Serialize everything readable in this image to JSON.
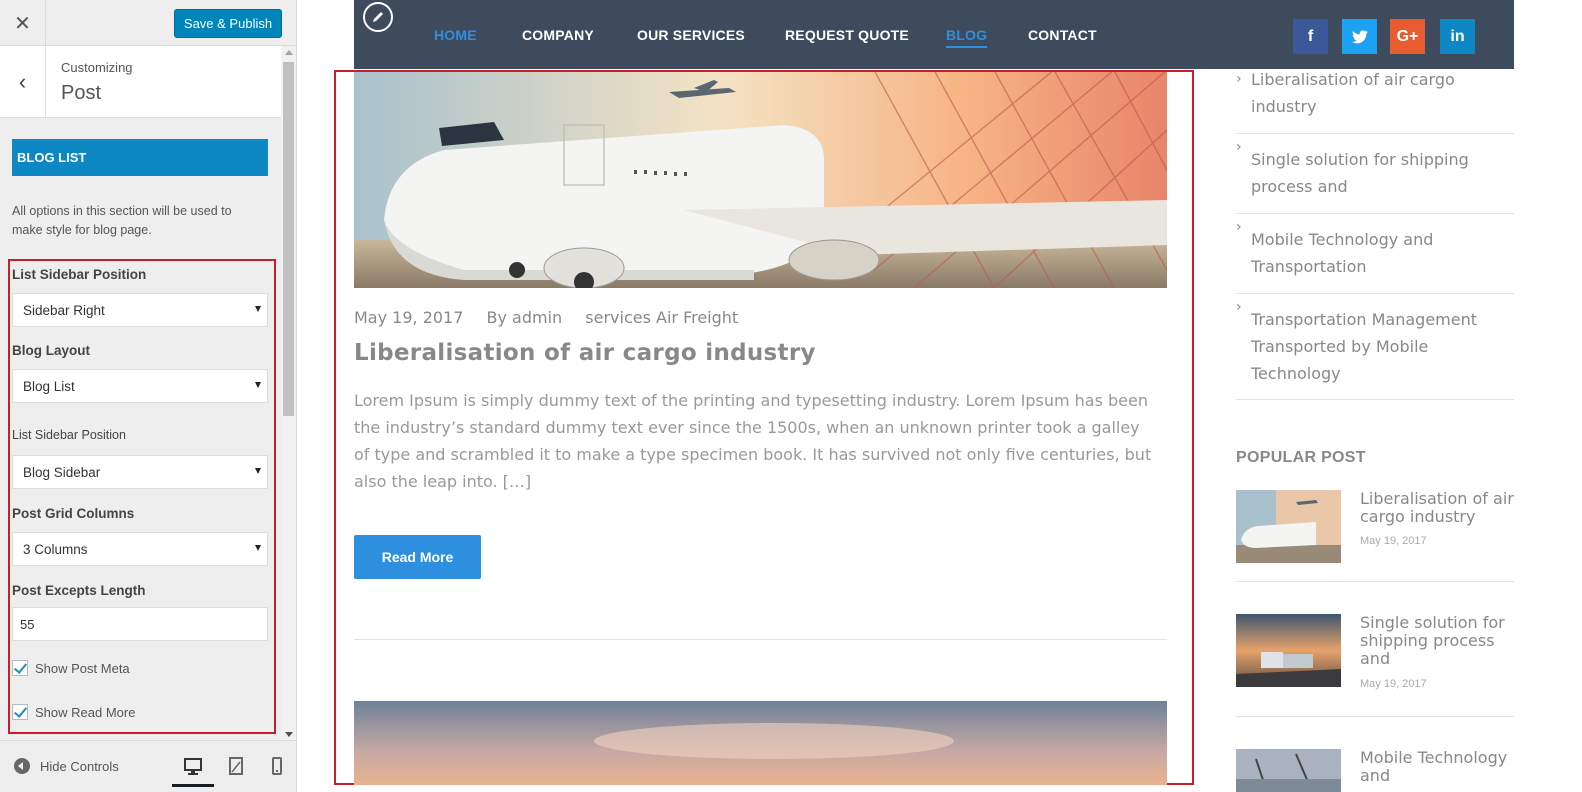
{
  "customizer": {
    "close_label": "✕",
    "publish_label": "Save & Publish",
    "breadcrumb_small": "Customizing",
    "breadcrumb_title": "Post",
    "section_label": "BLOG LIST",
    "section_desc": "All options in this section will be used to make style for blog page.",
    "options": {
      "list_sidebar_position_label": "List Sidebar Position",
      "list_sidebar_position_value": "Sidebar Right",
      "blog_layout_label": "Blog Layout",
      "blog_layout_value": "Blog List",
      "list_sidebar_position2_label": "List Sidebar Position",
      "list_sidebar_position2_value": "Blog Sidebar",
      "post_grid_columns_label": "Post Grid Columns",
      "post_grid_columns_value": "3 Columns",
      "post_excerpts_length_label": "Post Excepts Length",
      "post_excerpts_length_value": "55",
      "show_post_meta_label": "Show Post Meta",
      "show_read_more_label": "Show Read More"
    },
    "footer": {
      "hide_controls_label": "Hide Controls"
    }
  },
  "nav": {
    "items": [
      "HOME",
      "COMPANY",
      "OUR SERVICES",
      "REQUEST QUOTE",
      "BLOG",
      "CONTACT"
    ],
    "social": {
      "facebook": "f",
      "twitter": "t",
      "google": "G+",
      "linkedin": "in"
    },
    "colors": {
      "bar": "#3d4b5c",
      "accent": "#2e8fdf"
    }
  },
  "post": {
    "date": "May 19, 2017",
    "author": "By admin",
    "category": "services Air Freight",
    "title": "Liberalisation of air cargo industry",
    "excerpt": "Lorem Ipsum is simply dummy text of the printing and typesetting industry. Lorem Ipsum has been the industry’s standard dummy text ever since the 1500s, when an unknown printer took a galley of type and scrambled it to make a type specimen book. It has survived not only five centuries, but also the leap into. […]",
    "read_more": "Read More"
  },
  "sidebar": {
    "recent": [
      "Liberalisation of air cargo industry",
      "Single solution for shipping process and",
      "Mobile Technology and Transportation",
      "Transportation Management Transported by Mobile Technology"
    ],
    "popular_title": "POPULAR POST",
    "popular": [
      {
        "title": "Liberalisation of air cargo industry",
        "date": "May 19, 2017"
      },
      {
        "title": "Single solution for shipping process and",
        "date": "May 19, 2017"
      },
      {
        "title": "Mobile Technology and",
        "date": ""
      }
    ]
  }
}
